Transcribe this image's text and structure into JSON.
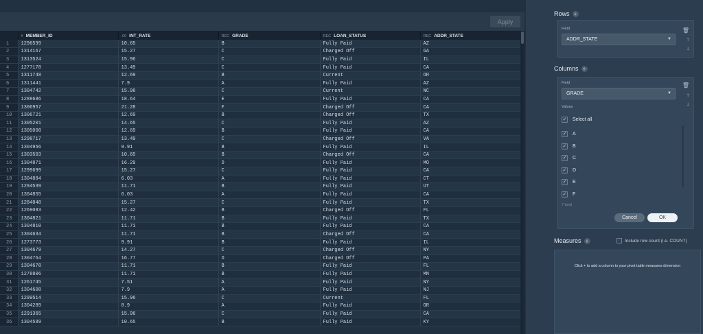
{
  "toolbar": {
    "apply_label": "Apply"
  },
  "table": {
    "columns": [
      {
        "type": "#",
        "name": "MEMBER_ID"
      },
      {
        "type": ".00",
        "name": "INT_RATE"
      },
      {
        "type": "REC",
        "name": "GRADE"
      },
      {
        "type": "REC",
        "name": "LOAN_STATUS"
      },
      {
        "type": "REC",
        "name": "ADDR_STATE"
      }
    ],
    "rows": [
      [
        "1",
        "1296599",
        "10.65",
        "B",
        "Fully Paid",
        "AZ"
      ],
      [
        "2",
        "1314167",
        "15.27",
        "C",
        "Charged Off",
        "GA"
      ],
      [
        "3",
        "1313524",
        "15.96",
        "C",
        "Fully Paid",
        "IL"
      ],
      [
        "4",
        "1277178",
        "13.49",
        "C",
        "Fully Paid",
        "CA"
      ],
      [
        "5",
        "1311748",
        "12.69",
        "B",
        "Current",
        "OR"
      ],
      [
        "6",
        "1311441",
        "7.9",
        "A",
        "Fully Paid",
        "AZ"
      ],
      [
        "7",
        "1304742",
        "15.96",
        "C",
        "Current",
        "NC"
      ],
      [
        "8",
        "1288686",
        "18.64",
        "E",
        "Fully Paid",
        "CA"
      ],
      [
        "9",
        "1306957",
        "21.28",
        "F",
        "Charged Off",
        "CA"
      ],
      [
        "10",
        "1306721",
        "12.69",
        "B",
        "Charged Off",
        "TX"
      ],
      [
        "11",
        "1305201",
        "14.65",
        "C",
        "Fully Paid",
        "AZ"
      ],
      [
        "12",
        "1305008",
        "12.69",
        "B",
        "Fully Paid",
        "CA"
      ],
      [
        "13",
        "1298717",
        "13.49",
        "C",
        "Charged Off",
        "VA"
      ],
      [
        "14",
        "1304956",
        "9.91",
        "B",
        "Fully Paid",
        "IL"
      ],
      [
        "15",
        "1303503",
        "10.65",
        "B",
        "Charged Off",
        "CA"
      ],
      [
        "16",
        "1304871",
        "16.29",
        "D",
        "Fully Paid",
        "MO"
      ],
      [
        "17",
        "1299699",
        "15.27",
        "C",
        "Fully Paid",
        "CA"
      ],
      [
        "18",
        "1304884",
        "6.03",
        "A",
        "Fully Paid",
        "CT"
      ],
      [
        "19",
        "1294539",
        "11.71",
        "B",
        "Fully Paid",
        "UT"
      ],
      [
        "20",
        "1304855",
        "6.03",
        "A",
        "Fully Paid",
        "CA"
      ],
      [
        "21",
        "1284848",
        "15.27",
        "C",
        "Fully Paid",
        "TX"
      ],
      [
        "22",
        "1269083",
        "12.42",
        "B",
        "Charged Off",
        "FL"
      ],
      [
        "23",
        "1304821",
        "11.71",
        "B",
        "Fully Paid",
        "TX"
      ],
      [
        "24",
        "1304810",
        "11.71",
        "B",
        "Fully Paid",
        "CA"
      ],
      [
        "25",
        "1304634",
        "11.71",
        "B",
        "Charged Off",
        "CA"
      ],
      [
        "26",
        "1273773",
        "9.91",
        "B",
        "Fully Paid",
        "IL"
      ],
      [
        "27",
        "1304679",
        "14.27",
        "C",
        "Charged Off",
        "NY"
      ],
      [
        "28",
        "1304764",
        "16.77",
        "D",
        "Charged Off",
        "PA"
      ],
      [
        "29",
        "1304678",
        "11.71",
        "B",
        "Fully Paid",
        "FL"
      ],
      [
        "30",
        "1278806",
        "11.71",
        "B",
        "Fully Paid",
        "MN"
      ],
      [
        "31",
        "1261745",
        "7.51",
        "A",
        "Fully Paid",
        "NY"
      ],
      [
        "32",
        "1304608",
        "7.9",
        "A",
        "Fully Paid",
        "NJ"
      ],
      [
        "33",
        "1299514",
        "15.96",
        "C",
        "Current",
        "FL"
      ],
      [
        "34",
        "1304289",
        "8.9",
        "A",
        "Fully Paid",
        "OR"
      ],
      [
        "35",
        "1291365",
        "15.96",
        "C",
        "Fully Paid",
        "CA"
      ],
      [
        "36",
        "1304589",
        "10.65",
        "B",
        "Fully Paid",
        "KY"
      ]
    ]
  },
  "rows_section": {
    "title": "Rows",
    "field_label": "Field",
    "field_value": "ADDR_STATE"
  },
  "columns_section": {
    "title": "Columns",
    "field_label": "Field",
    "field_value": "GRADE",
    "values_label": "Values",
    "select_all_label": "Select all",
    "values": [
      "A",
      "B",
      "C",
      "D",
      "E",
      "F"
    ],
    "total_label": "7 total",
    "cancel_label": "Cancel",
    "ok_label": "OK"
  },
  "measures_section": {
    "title": "Measures",
    "include_label": "Include row count (i.e. COUNT)",
    "hint": "Click + to add a column to your pivot table measures dimension"
  },
  "colors": {
    "panel": "#2b3d4f",
    "grid_bg": "#223140",
    "accent_light": "#eef2f5"
  }
}
